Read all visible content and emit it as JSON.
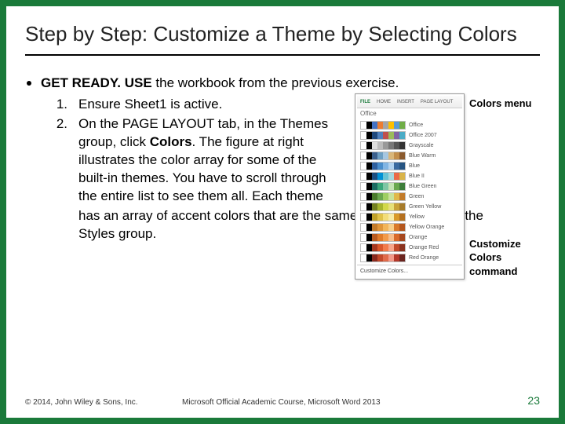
{
  "title": "Step by Step: Customize a Theme by Selecting Colors",
  "intro_bold": "GET READY. USE",
  "intro_rest": " the workbook from the previous exercise.",
  "steps": {
    "s1_num": "1.",
    "s1_text": "Ensure Sheet1 is active.",
    "s2_num": "2.",
    "s2_text_a": "On the PAGE LAYOUT tab, in the Themes group, click ",
    "s2_text_bold": "Colors",
    "s2_text_b": ". The figure at right illustrates the color array for some of the built-in themes. You have to scroll through the entire list to see them all. Each theme",
    "s2_text_c": "has an array of accent colors that are the same as the accents in the Styles group."
  },
  "figure": {
    "ribbon": {
      "file": "FILE",
      "home": "HOME",
      "insert": "INSERT",
      "layout": "PAGE LAYOUT"
    },
    "heading": "Office",
    "themes": [
      {
        "name": "Office",
        "c": [
          "#fff",
          "#000",
          "#4472c4",
          "#ed7d31",
          "#a5a5a5",
          "#ffc000",
          "#5b9bd5",
          "#70ad47"
        ]
      },
      {
        "name": "Office 2007",
        "c": [
          "#fff",
          "#000",
          "#1f497d",
          "#4f81bd",
          "#c0504d",
          "#9bbb59",
          "#8064a2",
          "#4bacc6"
        ]
      },
      {
        "name": "Grayscale",
        "c": [
          "#fff",
          "#000",
          "#ddd",
          "#bbb",
          "#999",
          "#777",
          "#555",
          "#333"
        ]
      },
      {
        "name": "Blue Warm",
        "c": [
          "#fff",
          "#000",
          "#3b608d",
          "#6ea0c4",
          "#a6c7e1",
          "#d9b679",
          "#c28e4b",
          "#8a5a2e"
        ]
      },
      {
        "name": "Blue",
        "c": [
          "#fff",
          "#000",
          "#2e5f9e",
          "#4a8ecc",
          "#82b5e3",
          "#b3d3ef",
          "#3a6aa0",
          "#265481"
        ]
      },
      {
        "name": "Blue II",
        "c": [
          "#fff",
          "#000",
          "#1c4e80",
          "#0091d5",
          "#67c2d4",
          "#a5d8dd",
          "#ea6a47",
          "#d9b44a"
        ]
      },
      {
        "name": "Blue Green",
        "c": [
          "#fff",
          "#000",
          "#1b6b62",
          "#3aa77b",
          "#7fc6a4",
          "#c4e3b4",
          "#6aa84f",
          "#3d7d3a"
        ]
      },
      {
        "name": "Green",
        "c": [
          "#fff",
          "#000",
          "#4a7b2b",
          "#6aa84f",
          "#9fce63",
          "#c8e29b",
          "#e0b84a",
          "#c27b2a"
        ]
      },
      {
        "name": "Green Yellow",
        "c": [
          "#fff",
          "#000",
          "#738020",
          "#a6b52e",
          "#d2d84a",
          "#e6e07a",
          "#c8a23a",
          "#a67b2a"
        ]
      },
      {
        "name": "Yellow",
        "c": [
          "#fff",
          "#000",
          "#bfa12a",
          "#e0c24a",
          "#f2dd7a",
          "#f7eba6",
          "#d99a2a",
          "#b4701f"
        ]
      },
      {
        "name": "Yellow Orange",
        "c": [
          "#fff",
          "#000",
          "#c27b2a",
          "#e0963a",
          "#f2b55a",
          "#f7cf8a",
          "#d97a2a",
          "#b4571f"
        ]
      },
      {
        "name": "Orange",
        "c": [
          "#fff",
          "#000",
          "#b85a1f",
          "#e07b2a",
          "#f29a4a",
          "#f7bd8a",
          "#d96a2a",
          "#a6481f"
        ]
      },
      {
        "name": "Orange Red",
        "c": [
          "#fff",
          "#000",
          "#a6381f",
          "#d9572a",
          "#f27b4a",
          "#f7a68a",
          "#c24a2a",
          "#8a321f"
        ]
      },
      {
        "name": "Red Orange",
        "c": [
          "#fff",
          "#000",
          "#8a2a1f",
          "#c2482a",
          "#e06a4a",
          "#f29a8a",
          "#b4382a",
          "#6a241f"
        ]
      }
    ],
    "customize": "Customize Colors...",
    "label_top": "Colors menu",
    "label_bottom": "Customize Colors command"
  },
  "footer": {
    "copyright": "© 2014, John Wiley & Sons, Inc.",
    "course": "Microsoft Official Academic Course, Microsoft Word 2013",
    "page": "23"
  }
}
